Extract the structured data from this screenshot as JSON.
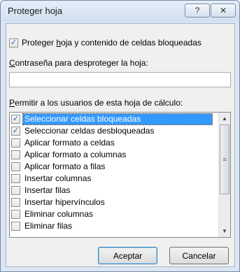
{
  "dialog": {
    "title": "Proteger hoja",
    "help_icon": "?",
    "close_icon": "✕"
  },
  "protect": {
    "checked": true,
    "label_pre": "Proteger ",
    "label_u": "h",
    "label_post": "oja y contenido de celdas bloqueadas"
  },
  "password": {
    "label_u": "C",
    "label_post": "ontraseña para desproteger la hoja:",
    "value": ""
  },
  "permissions": {
    "label_u": "P",
    "label_post": "ermitir a los usuarios de esta hoja de cálculo:",
    "items": [
      {
        "label": "Seleccionar celdas bloqueadas",
        "checked": true,
        "selected": true
      },
      {
        "label": "Seleccionar celdas desbloqueadas",
        "checked": true,
        "selected": false
      },
      {
        "label": "Aplicar formato a celdas",
        "checked": false,
        "selected": false
      },
      {
        "label": "Aplicar formato a columnas",
        "checked": false,
        "selected": false
      },
      {
        "label": "Aplicar formato a filas",
        "checked": false,
        "selected": false
      },
      {
        "label": "Insertar columnas",
        "checked": false,
        "selected": false
      },
      {
        "label": "Insertar filas",
        "checked": false,
        "selected": false
      },
      {
        "label": "Insertar hipervínculos",
        "checked": false,
        "selected": false
      },
      {
        "label": "Eliminar columnas",
        "checked": false,
        "selected": false
      },
      {
        "label": "Eliminar filas",
        "checked": false,
        "selected": false
      }
    ],
    "scroll_up_icon": "▲",
    "scroll_down_icon": "▼",
    "scroll_grip_icon": "≡"
  },
  "buttons": {
    "ok": "Aceptar",
    "cancel": "Cancelar"
  },
  "colors": {
    "selection": "#3399ff",
    "title_bar": "#dbe6f3",
    "check": "#2b5fb4"
  }
}
